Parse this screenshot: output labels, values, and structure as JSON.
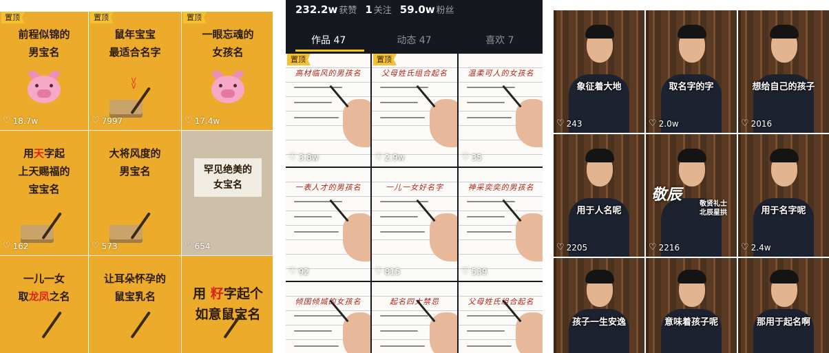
{
  "panel1": {
    "pin_label": "置顶",
    "tiles": [
      {
        "title": "前程似锦的\n男宝名",
        "likes": "18.7w",
        "pinned": true,
        "art": "pig"
      },
      {
        "title": "鼠年宝宝\n最适合名字",
        "likes": "7997",
        "pinned": true,
        "art": "scroll"
      },
      {
        "title": "一眼忘魂的\n女孩名",
        "likes": "17.4w",
        "pinned": true,
        "art": "pig"
      },
      {
        "title_parts": [
          "用",
          "天",
          "字起\n上天赐福的\n宝宝名"
        ],
        "likes": "162",
        "art": "scroll"
      },
      {
        "title": "大将风度的\n男宝名",
        "likes": "573",
        "art": "scroll"
      },
      {
        "title": "罕见绝美的\n女宝名",
        "likes": "654",
        "art": "none",
        "gray": true
      },
      {
        "title_parts": [
          "一儿一女\n取",
          "龙凤",
          "之名"
        ],
        "likes": "",
        "art": "brush"
      },
      {
        "title": "让耳朵怀孕的\n鼠宝乳名",
        "likes": "",
        "art": "brush"
      },
      {
        "title_parts": [
          "用 ",
          "籽",
          "字起个\n如意鼠宝名"
        ],
        "likes": "",
        "art": "brush",
        "big": true
      }
    ]
  },
  "panel2": {
    "stats": [
      {
        "value": "232.2w",
        "label": "获赞"
      },
      {
        "value": "1",
        "label": "关注"
      },
      {
        "value": "59.0w",
        "label": "粉丝"
      }
    ],
    "tabs": [
      {
        "label": "作品 47",
        "active": true
      },
      {
        "label": "动态 47",
        "active": false
      },
      {
        "label": "喜欢 7",
        "active": false
      }
    ],
    "pin_label": "置顶",
    "tiles": [
      {
        "title": "高材临风的男孩名",
        "likes": "3.8w",
        "pinned": true
      },
      {
        "title": "父母姓氏组合起名",
        "likes": "2.9w",
        "pinned": true
      },
      {
        "title": "温柔可人的女孩名",
        "likes": "35"
      },
      {
        "title": "一表人才的男孩名",
        "likes": "92"
      },
      {
        "title": "一儿一女好名字",
        "likes": "815"
      },
      {
        "title": "神采奕奕的男孩名",
        "likes": "539"
      },
      {
        "title": "倾国倾城的女孩名",
        "likes": ""
      },
      {
        "title": "起名四大禁忌",
        "likes": ""
      },
      {
        "title": "父母姓氏组合起名",
        "likes": ""
      }
    ]
  },
  "panel3": {
    "overlay_big": "敬辰",
    "overlay_small": "敬贤礼士\n北辰星拱",
    "tiles": [
      {
        "caption": "象征着大地",
        "likes": "243"
      },
      {
        "caption": "取名字的字",
        "likes": "2.0w"
      },
      {
        "caption": "想给自己的孩子",
        "likes": "2016"
      },
      {
        "caption": "用于人名呢",
        "likes": "2205"
      },
      {
        "caption": "",
        "likes": "2216",
        "overlay": true
      },
      {
        "caption": "用于名字呢",
        "likes": "2.4w"
      },
      {
        "caption": "孩子一生安逸",
        "likes": ""
      },
      {
        "caption": "意味着孩子呢",
        "likes": ""
      },
      {
        "caption": "那用于起名啊",
        "likes": ""
      }
    ]
  },
  "colors": {
    "accent": "#f5c518",
    "tile_orange": "#ecab2b",
    "highlight_red": "#d8261c"
  },
  "icons": {
    "like": "heart-outline-icon",
    "pin": "pin-badge"
  }
}
